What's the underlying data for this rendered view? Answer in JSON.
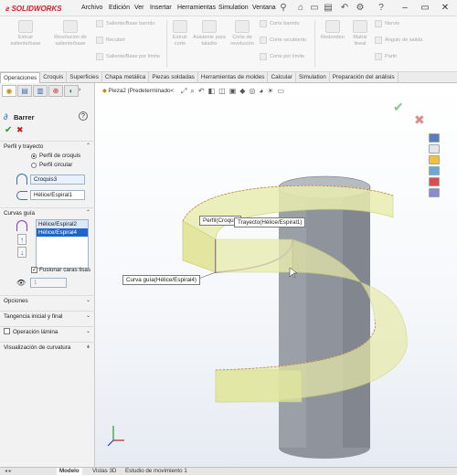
{
  "app": {
    "name": "SOLIDWORKS"
  },
  "menu": [
    "Archivo",
    "Edición",
    "Ver",
    "Insertar",
    "Herramientas",
    "Simulation",
    "Ventana"
  ],
  "command_manager": {
    "big_buttons": [
      {
        "label": "Extruir saliente/base"
      },
      {
        "label": "Revolución de saliente/base"
      },
      {
        "label": "Extruir corte"
      },
      {
        "label": "Asistente para taladro"
      },
      {
        "label": "Corte de revolución"
      },
      {
        "label": "Redondeo"
      },
      {
        "label": "Matriz lineal"
      }
    ],
    "small_rows": [
      {
        "label": "Saliente/Base barrido"
      },
      {
        "label": "Recubrir"
      },
      {
        "label": "Saliente/Base por límite"
      },
      {
        "label": "Corte barrido"
      },
      {
        "label": "Corte recubierto"
      },
      {
        "label": "Corte por límite"
      },
      {
        "label": "Nervio"
      },
      {
        "label": "Ángulo de salida"
      },
      {
        "label": "Partir"
      }
    ]
  },
  "tabs": [
    "Operaciones",
    "Croquis",
    "Superficies",
    "Chapa metálica",
    "Piezas soldadas",
    "Herramientas de moldes",
    "Calcular",
    "Simulation",
    "Preparación del análisis"
  ],
  "breadcrumb": "Pieza2 (Predeterminado<",
  "panel": {
    "title": "Barrer",
    "profile_section": "Perfil y trayecto",
    "radio_sketch": "Perfil de croquis",
    "radio_circular": "Perfil circular",
    "profile_value": "Croquis3",
    "path_value": "Hélice/Espiral1",
    "guides_section": "Curvas guía",
    "guide_items": [
      "Hélice/Espiral2",
      "Hélice/Espiral4"
    ],
    "merge_label": "Fusionar caras lisas",
    "spinner_value": "1",
    "sections": [
      "Opciones",
      "Tangencia inicial y final",
      "Operación lámina",
      "Visualización de curvatura"
    ]
  },
  "callouts": {
    "profile": "Perfil(Croquis",
    "path": "Trayecto(Hélice/Espiral1)",
    "guide": "Curva guía(Hélice/Espiral4)"
  },
  "bottom_tabs": [
    "Modelo",
    "Vistas 3D",
    "Estudio de movimiento 1"
  ],
  "colors": {
    "accent_blue": "#1f65c8",
    "brand_red": "#d0202a",
    "helix_fill": "#e9edb0",
    "cylinder": "#8f949c"
  }
}
